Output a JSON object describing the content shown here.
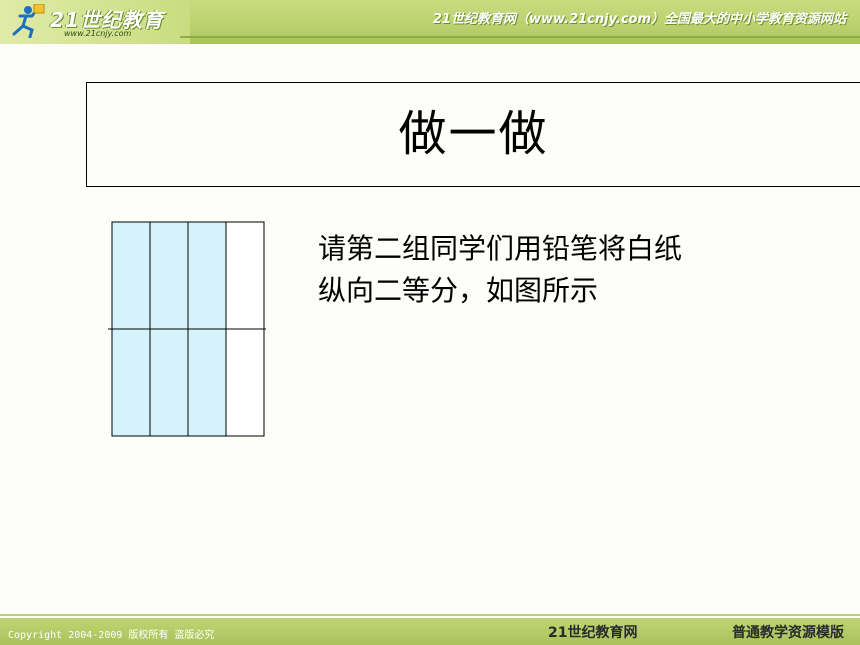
{
  "header": {
    "logo_text": "21世纪教育",
    "logo_url": "www.21cnjy.com",
    "site_title": "21世纪教育网（www.21cnjy.com）全国最大的中小学教育资源网站"
  },
  "slide": {
    "title": "做一做",
    "body_lines": [
      "请第二组同学们用铅笔将白纸",
      "纵向二等分，如图所示"
    ]
  },
  "diagram": {
    "columns": 4,
    "rows": 2,
    "shaded_columns": [
      1,
      2,
      3
    ],
    "shade_color": "#d6f3fb",
    "line_color": "#000000"
  },
  "footer": {
    "copyright": "Copyright 2004-2009 版权所有 盗版必究",
    "brand": "21世纪教育网",
    "template_label": "普通教学资源模版"
  },
  "colors": {
    "header_green": "#c9dc80",
    "footer_green": "#b3ca66",
    "background": "#fdfdf9"
  }
}
